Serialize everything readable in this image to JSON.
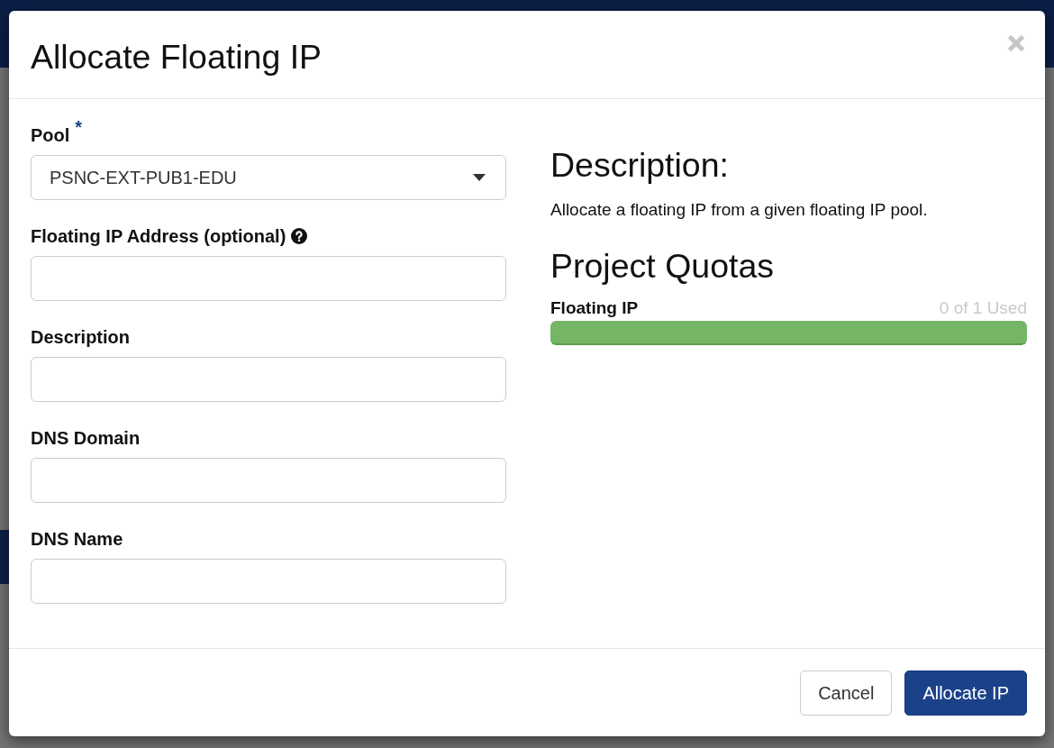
{
  "modal": {
    "title": "Allocate Floating IP",
    "form": {
      "fields": [
        {
          "kind": "select",
          "label": "Pool",
          "required_mark": "*",
          "value": "PSNC-EXT-PUB1-EDU"
        },
        {
          "kind": "text",
          "label": "Floating IP Address (optional)",
          "help_icon": true
        },
        {
          "kind": "text",
          "label": "Description"
        },
        {
          "kind": "text",
          "label": "DNS Domain"
        },
        {
          "kind": "text",
          "label": "DNS Name"
        }
      ]
    },
    "description": {
      "heading": "Description:",
      "text": "Allocate a floating IP from a given floating IP pool."
    },
    "quotas": {
      "heading": "Project Quotas",
      "items": [
        {
          "label": "Floating IP",
          "reading": "0 of 1 Used",
          "level": 1
        }
      ]
    },
    "buttons": [
      {
        "label": "Cancel",
        "kind": "secondary"
      },
      {
        "label": "Allocate IP",
        "kind": "primary"
      }
    ]
  }
}
